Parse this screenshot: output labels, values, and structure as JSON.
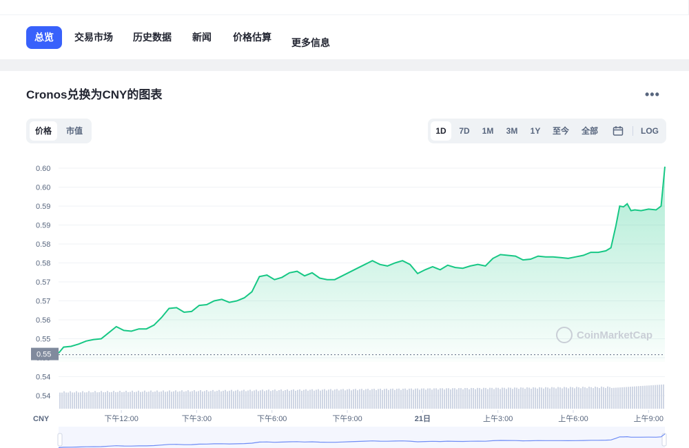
{
  "nav": {
    "tabs": [
      {
        "label": "总览",
        "active": true
      },
      {
        "label": "交易市场"
      },
      {
        "label": "历史数据"
      },
      {
        "label": "新闻"
      },
      {
        "label": "价格估算"
      },
      {
        "label": "更多信息"
      }
    ]
  },
  "chart_header": {
    "title": "Cronos兑换为CNY的图表",
    "more_icon": "more-horizontal-icon",
    "type_toggle": [
      "价格",
      "市值"
    ],
    "ranges": [
      "1D",
      "7D",
      "1M",
      "3M",
      "1Y",
      "至今",
      "全部"
    ],
    "calendar_icon": "calendar-icon",
    "log_label": "LOG"
  },
  "watermark": {
    "text": "CoinMarketCap",
    "icon": "coinmarketcap-logo-icon"
  },
  "colors": {
    "accent": "#3861fb",
    "line": "#16c784",
    "volume": "#cfd6e4",
    "navigator_line": "#6d8bf5"
  },
  "chart_data": {
    "type": "line",
    "currency_label": "CNY",
    "current_price_label": "0.55",
    "y_tick_labels": [
      "0.60",
      "0.60",
      "0.59",
      "0.59",
      "0.58",
      "0.58",
      "0.57",
      "0.57",
      "0.56",
      "0.55",
      "0.55",
      "0.54",
      "0.54"
    ],
    "y_tick_values": [
      0.6025,
      0.6,
      0.5975,
      0.595,
      0.5925,
      0.59,
      0.5875,
      0.585,
      0.5825,
      0.58,
      0.5775,
      0.575,
      0.5725
    ],
    "ylim": [
      0.5715,
      0.6035
    ],
    "x_tick_labels": [
      "下午12:00",
      "下午3:00",
      "下午6:00",
      "下午9:00",
      "21日",
      "上午3:00",
      "上午6:00",
      "上午9:00"
    ],
    "x_tick_hours": [
      2.5,
      5.5,
      8.5,
      11.5,
      14.5,
      17.5,
      20.5,
      23.5
    ],
    "x_range_hours": [
      0,
      24.15
    ],
    "current_price": 0.5779,
    "series": [
      {
        "x": [
          0,
          0.2,
          0.5,
          0.8,
          1.1,
          1.4,
          1.7,
          2.0,
          2.3,
          2.6,
          2.9,
          3.2,
          3.5,
          3.8,
          4.1,
          4.4,
          4.7,
          5.0,
          5.3,
          5.6,
          5.9,
          6.2,
          6.5,
          6.8,
          7.1,
          7.4,
          7.7,
          8.0,
          8.3,
          8.6,
          8.9,
          9.2,
          9.5,
          9.8,
          10.1,
          10.4,
          10.7,
          11.0,
          11.3,
          11.6,
          11.9,
          12.2,
          12.5,
          12.8,
          13.1,
          13.4,
          13.7,
          14.0,
          14.3,
          14.6,
          14.9,
          15.2,
          15.5,
          15.8,
          16.1,
          16.4,
          16.7,
          17.0,
          17.3,
          17.6,
          17.9,
          18.2,
          18.5,
          18.8,
          19.1,
          19.4,
          19.7,
          20.0,
          20.3,
          20.6,
          20.9,
          21.2,
          21.5,
          21.8,
          22.0,
          22.2,
          22.35,
          22.5,
          22.65,
          22.8,
          22.95,
          23.2,
          23.5,
          23.8,
          24.0,
          24.15
        ],
        "y": [
          0.5781,
          0.5789,
          0.579,
          0.5793,
          0.5797,
          0.5799,
          0.58,
          0.5808,
          0.5816,
          0.5811,
          0.581,
          0.5813,
          0.5813,
          0.5818,
          0.5828,
          0.584,
          0.5841,
          0.5835,
          0.5836,
          0.5844,
          0.5845,
          0.585,
          0.5852,
          0.5848,
          0.585,
          0.5854,
          0.5862,
          0.5882,
          0.5884,
          0.5878,
          0.5881,
          0.5887,
          0.5889,
          0.5883,
          0.5887,
          0.588,
          0.5878,
          0.5878,
          0.5883,
          0.5888,
          0.5893,
          0.5898,
          0.5903,
          0.5898,
          0.5896,
          0.59,
          0.5903,
          0.5898,
          0.5886,
          0.5891,
          0.5895,
          0.5891,
          0.5897,
          0.5894,
          0.5893,
          0.5896,
          0.5898,
          0.5896,
          0.5906,
          0.5911,
          0.591,
          0.5909,
          0.5904,
          0.5905,
          0.5909,
          0.5908,
          0.5908,
          0.5907,
          0.5906,
          0.5908,
          0.591,
          0.5914,
          0.5914,
          0.5916,
          0.592,
          0.5949,
          0.5975,
          0.5974,
          0.5978,
          0.5969,
          0.597,
          0.5969,
          0.5971,
          0.597,
          0.5975,
          0.6027
        ]
      }
    ]
  }
}
